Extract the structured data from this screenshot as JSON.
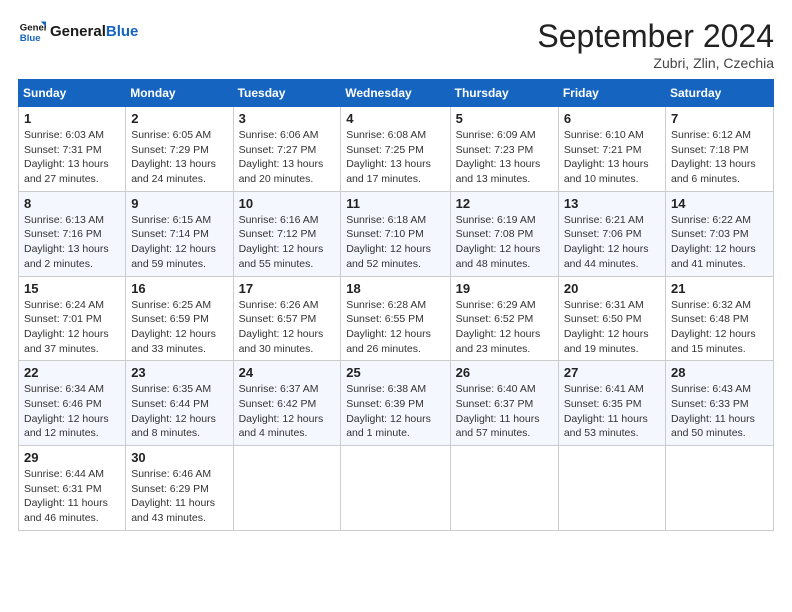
{
  "header": {
    "logo_line1": "General",
    "logo_line2": "Blue",
    "month_title": "September 2024",
    "subtitle": "Zubri, Zlin, Czechia"
  },
  "weekdays": [
    "Sunday",
    "Monday",
    "Tuesday",
    "Wednesday",
    "Thursday",
    "Friday",
    "Saturday"
  ],
  "weeks": [
    [
      {
        "day": "1",
        "info": "Sunrise: 6:03 AM\nSunset: 7:31 PM\nDaylight: 13 hours\nand 27 minutes."
      },
      {
        "day": "2",
        "info": "Sunrise: 6:05 AM\nSunset: 7:29 PM\nDaylight: 13 hours\nand 24 minutes."
      },
      {
        "day": "3",
        "info": "Sunrise: 6:06 AM\nSunset: 7:27 PM\nDaylight: 13 hours\nand 20 minutes."
      },
      {
        "day": "4",
        "info": "Sunrise: 6:08 AM\nSunset: 7:25 PM\nDaylight: 13 hours\nand 17 minutes."
      },
      {
        "day": "5",
        "info": "Sunrise: 6:09 AM\nSunset: 7:23 PM\nDaylight: 13 hours\nand 13 minutes."
      },
      {
        "day": "6",
        "info": "Sunrise: 6:10 AM\nSunset: 7:21 PM\nDaylight: 13 hours\nand 10 minutes."
      },
      {
        "day": "7",
        "info": "Sunrise: 6:12 AM\nSunset: 7:18 PM\nDaylight: 13 hours\nand 6 minutes."
      }
    ],
    [
      {
        "day": "8",
        "info": "Sunrise: 6:13 AM\nSunset: 7:16 PM\nDaylight: 13 hours\nand 2 minutes."
      },
      {
        "day": "9",
        "info": "Sunrise: 6:15 AM\nSunset: 7:14 PM\nDaylight: 12 hours\nand 59 minutes."
      },
      {
        "day": "10",
        "info": "Sunrise: 6:16 AM\nSunset: 7:12 PM\nDaylight: 12 hours\nand 55 minutes."
      },
      {
        "day": "11",
        "info": "Sunrise: 6:18 AM\nSunset: 7:10 PM\nDaylight: 12 hours\nand 52 minutes."
      },
      {
        "day": "12",
        "info": "Sunrise: 6:19 AM\nSunset: 7:08 PM\nDaylight: 12 hours\nand 48 minutes."
      },
      {
        "day": "13",
        "info": "Sunrise: 6:21 AM\nSunset: 7:06 PM\nDaylight: 12 hours\nand 44 minutes."
      },
      {
        "day": "14",
        "info": "Sunrise: 6:22 AM\nSunset: 7:03 PM\nDaylight: 12 hours\nand 41 minutes."
      }
    ],
    [
      {
        "day": "15",
        "info": "Sunrise: 6:24 AM\nSunset: 7:01 PM\nDaylight: 12 hours\nand 37 minutes."
      },
      {
        "day": "16",
        "info": "Sunrise: 6:25 AM\nSunset: 6:59 PM\nDaylight: 12 hours\nand 33 minutes."
      },
      {
        "day": "17",
        "info": "Sunrise: 6:26 AM\nSunset: 6:57 PM\nDaylight: 12 hours\nand 30 minutes."
      },
      {
        "day": "18",
        "info": "Sunrise: 6:28 AM\nSunset: 6:55 PM\nDaylight: 12 hours\nand 26 minutes."
      },
      {
        "day": "19",
        "info": "Sunrise: 6:29 AM\nSunset: 6:52 PM\nDaylight: 12 hours\nand 23 minutes."
      },
      {
        "day": "20",
        "info": "Sunrise: 6:31 AM\nSunset: 6:50 PM\nDaylight: 12 hours\nand 19 minutes."
      },
      {
        "day": "21",
        "info": "Sunrise: 6:32 AM\nSunset: 6:48 PM\nDaylight: 12 hours\nand 15 minutes."
      }
    ],
    [
      {
        "day": "22",
        "info": "Sunrise: 6:34 AM\nSunset: 6:46 PM\nDaylight: 12 hours\nand 12 minutes."
      },
      {
        "day": "23",
        "info": "Sunrise: 6:35 AM\nSunset: 6:44 PM\nDaylight: 12 hours\nand 8 minutes."
      },
      {
        "day": "24",
        "info": "Sunrise: 6:37 AM\nSunset: 6:42 PM\nDaylight: 12 hours\nand 4 minutes."
      },
      {
        "day": "25",
        "info": "Sunrise: 6:38 AM\nSunset: 6:39 PM\nDaylight: 12 hours\nand 1 minute."
      },
      {
        "day": "26",
        "info": "Sunrise: 6:40 AM\nSunset: 6:37 PM\nDaylight: 11 hours\nand 57 minutes."
      },
      {
        "day": "27",
        "info": "Sunrise: 6:41 AM\nSunset: 6:35 PM\nDaylight: 11 hours\nand 53 minutes."
      },
      {
        "day": "28",
        "info": "Sunrise: 6:43 AM\nSunset: 6:33 PM\nDaylight: 11 hours\nand 50 minutes."
      }
    ],
    [
      {
        "day": "29",
        "info": "Sunrise: 6:44 AM\nSunset: 6:31 PM\nDaylight: 11 hours\nand 46 minutes."
      },
      {
        "day": "30",
        "info": "Sunrise: 6:46 AM\nSunset: 6:29 PM\nDaylight: 11 hours\nand 43 minutes."
      },
      {
        "day": "",
        "info": ""
      },
      {
        "day": "",
        "info": ""
      },
      {
        "day": "",
        "info": ""
      },
      {
        "day": "",
        "info": ""
      },
      {
        "day": "",
        "info": ""
      }
    ]
  ]
}
